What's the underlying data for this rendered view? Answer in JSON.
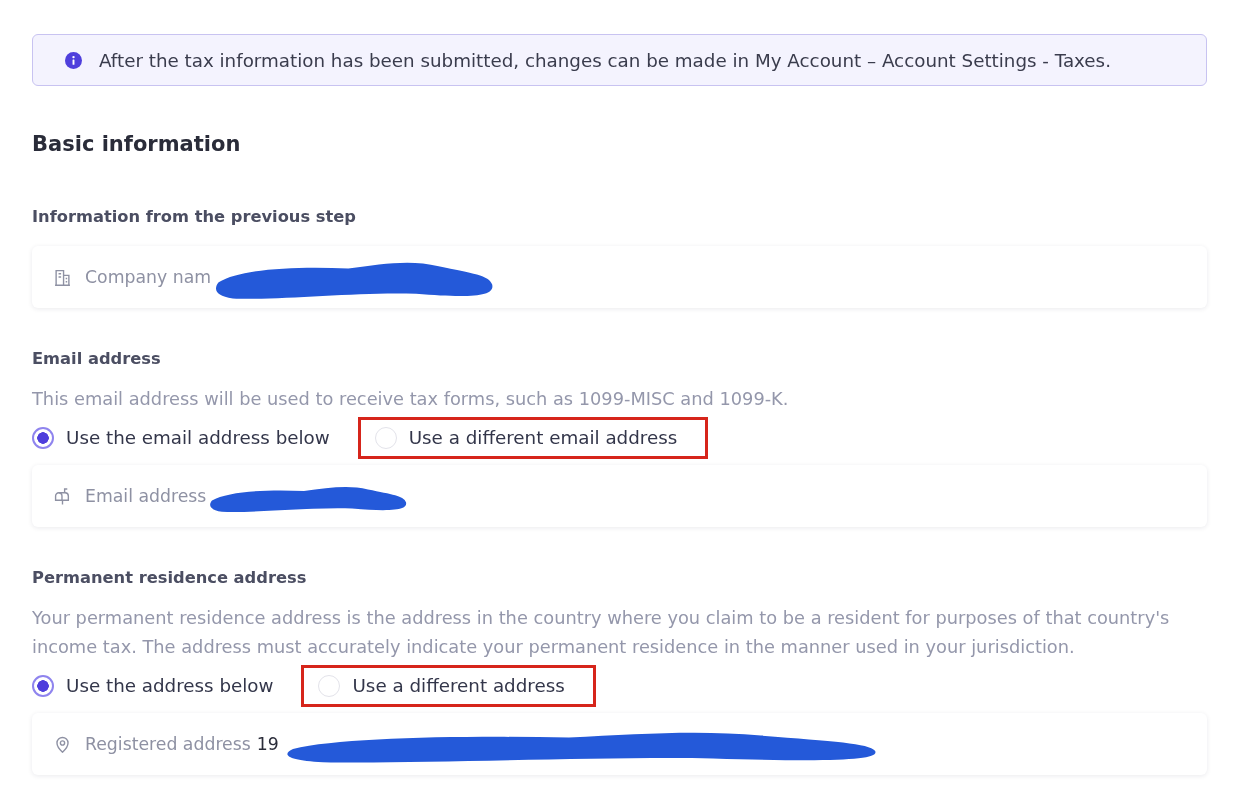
{
  "notice": {
    "text": "After the tax information has been submitted, changes can be made in My Account – Account Settings - Taxes."
  },
  "heading": "Basic information",
  "sections": [
    {
      "heading": "Information from the previous step",
      "field": {
        "kind": "company",
        "label": "Company nam",
        "redacted": true
      }
    },
    {
      "heading": "Email address",
      "description": "This email address will be used to receive tax forms, such as 1099-MISC and 1099-K.",
      "options": [
        {
          "label": "Use the email address below",
          "selected": true,
          "highlighted": false
        },
        {
          "label": "Use a different email address",
          "selected": false,
          "highlighted": true
        }
      ],
      "field": {
        "kind": "email",
        "label": "Email address",
        "redacted": true
      }
    },
    {
      "heading": "Permanent residence address",
      "description": "Your permanent residence address is the address in the country where you claim to be a resident for purposes of that country's income tax. The address must accurately indicate your permanent residence in the manner used in your jurisdiction.",
      "options": [
        {
          "label": "Use the address below",
          "selected": true,
          "highlighted": false
        },
        {
          "label": "Use a different address",
          "selected": false,
          "highlighted": true
        }
      ],
      "field": {
        "kind": "address",
        "label": "Registered address",
        "value": "19",
        "redacted": true
      }
    }
  ]
}
